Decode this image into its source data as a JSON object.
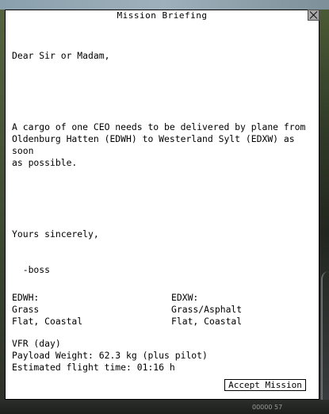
{
  "dialog": {
    "title": "Mission Briefing",
    "close_icon": "close-x-icon"
  },
  "letter": {
    "greeting": "Dear Sir or Madam,",
    "body": "A cargo of one CEO needs to be delivered by plane from\nOldenburg Hatten (EDWH) to Westerland Sylt (EDXW) as soon\nas possible.",
    "closing": "Yours sincerely,",
    "signature": "  -boss"
  },
  "departure": {
    "code": "EDWH:",
    "surface": "Grass",
    "terrain": "Flat, Coastal"
  },
  "arrival": {
    "code": "EDXW:",
    "surface": "Grass/Asphalt",
    "terrain": "Flat, Coastal"
  },
  "flight": {
    "rules": "VFR (day)",
    "payload": "Payload Weight: 62.3 kg (plus pilot)",
    "time": "Estimated flight time: 01:16 h"
  },
  "actions": {
    "accept_label": "Accept Mission"
  },
  "background": {
    "gauge_text": "00000 57"
  }
}
